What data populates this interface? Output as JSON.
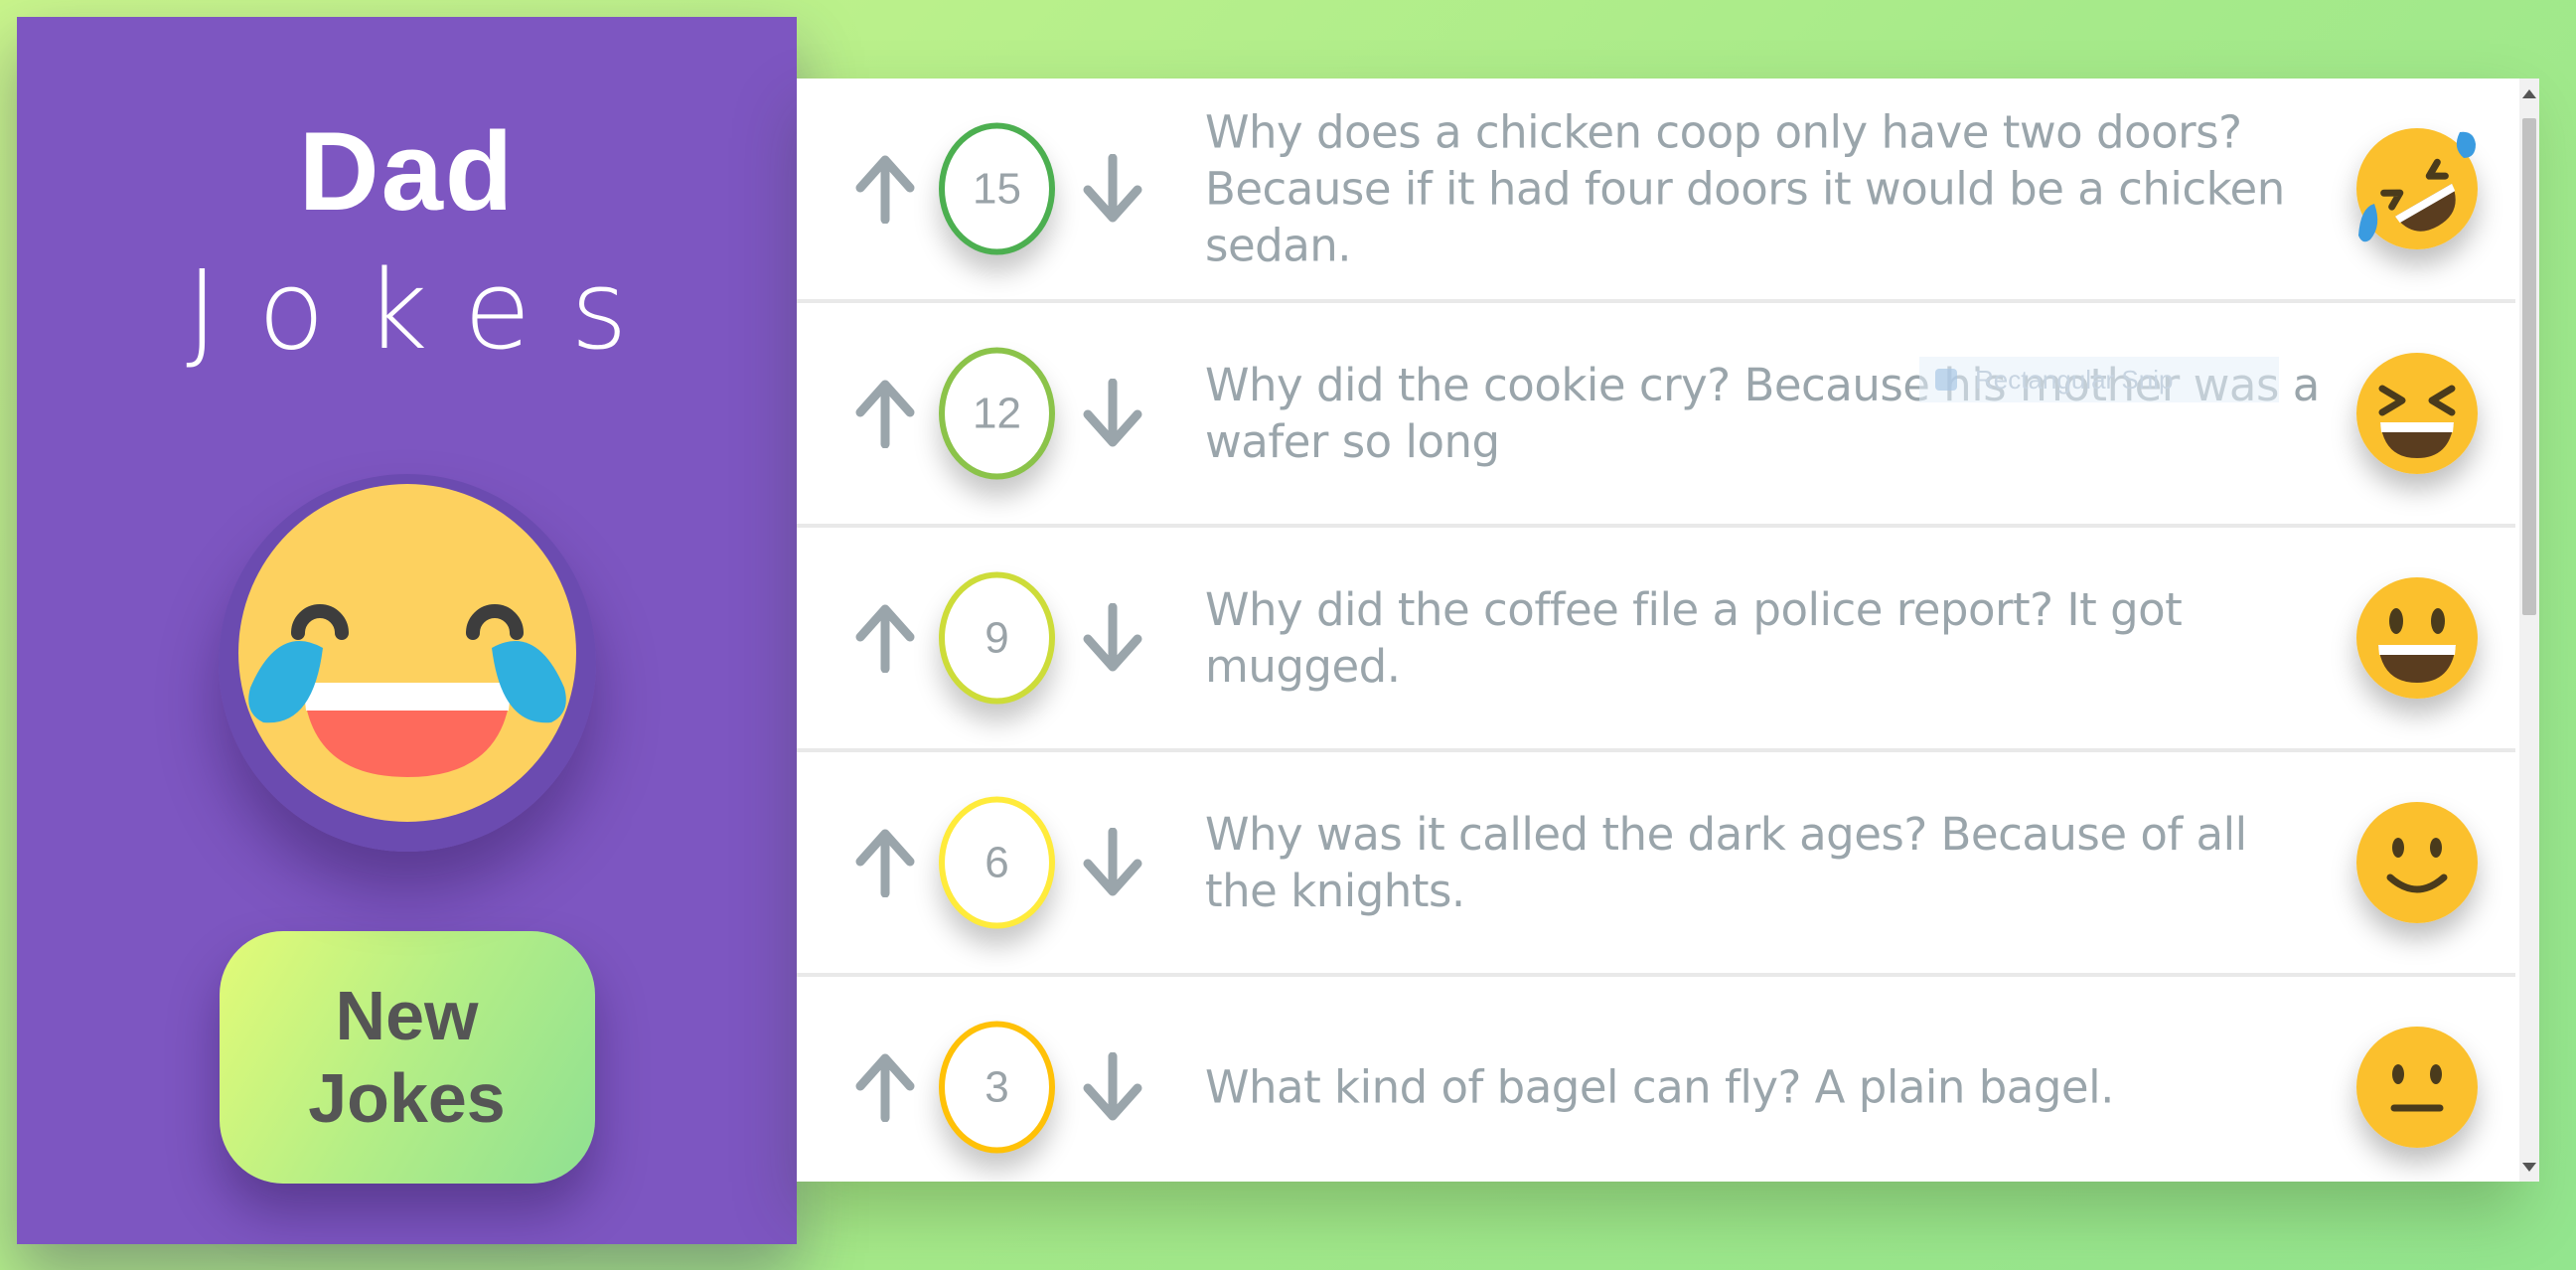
{
  "header": {
    "title_bold": "Dad",
    "title_light": "Jokes"
  },
  "sidebar": {
    "emoji_icon": "laughing-with-tears-icon",
    "new_button_label": "New Jokes"
  },
  "snip_overlay": {
    "label": "Rectangular Snip"
  },
  "colors": {
    "sidebar_bg": "#7d56c1",
    "page_gradient": [
      "#c9f58c",
      "#93e58e"
    ]
  },
  "jokes": [
    {
      "score": "15",
      "text": "Why does a chicken coop only have two doors? Because if it had four doors it would be a chicken sedan.",
      "score_color": "#4caf50",
      "face_icon": "rolling-on-floor-laughing-icon"
    },
    {
      "score": "12",
      "text": "Why did the cookie cry? Because his mother was a wafer so long",
      "score_color": "#8bc34a",
      "face_icon": "grinning-squinting-face-icon"
    },
    {
      "score": "9",
      "text": "Why did the coffee file a police report? It got mugged.",
      "score_color": "#cddc39",
      "face_icon": "grinning-face-icon"
    },
    {
      "score": "6",
      "text": "Why was it called the dark ages? Because of all the knights.",
      "score_color": "#ffeb3b",
      "face_icon": "slightly-smiling-face-icon"
    },
    {
      "score": "3",
      "text": "What kind of bagel can fly? A plain bagel.",
      "score_color": "#ffc107",
      "face_icon": "neutral-face-icon"
    }
  ]
}
